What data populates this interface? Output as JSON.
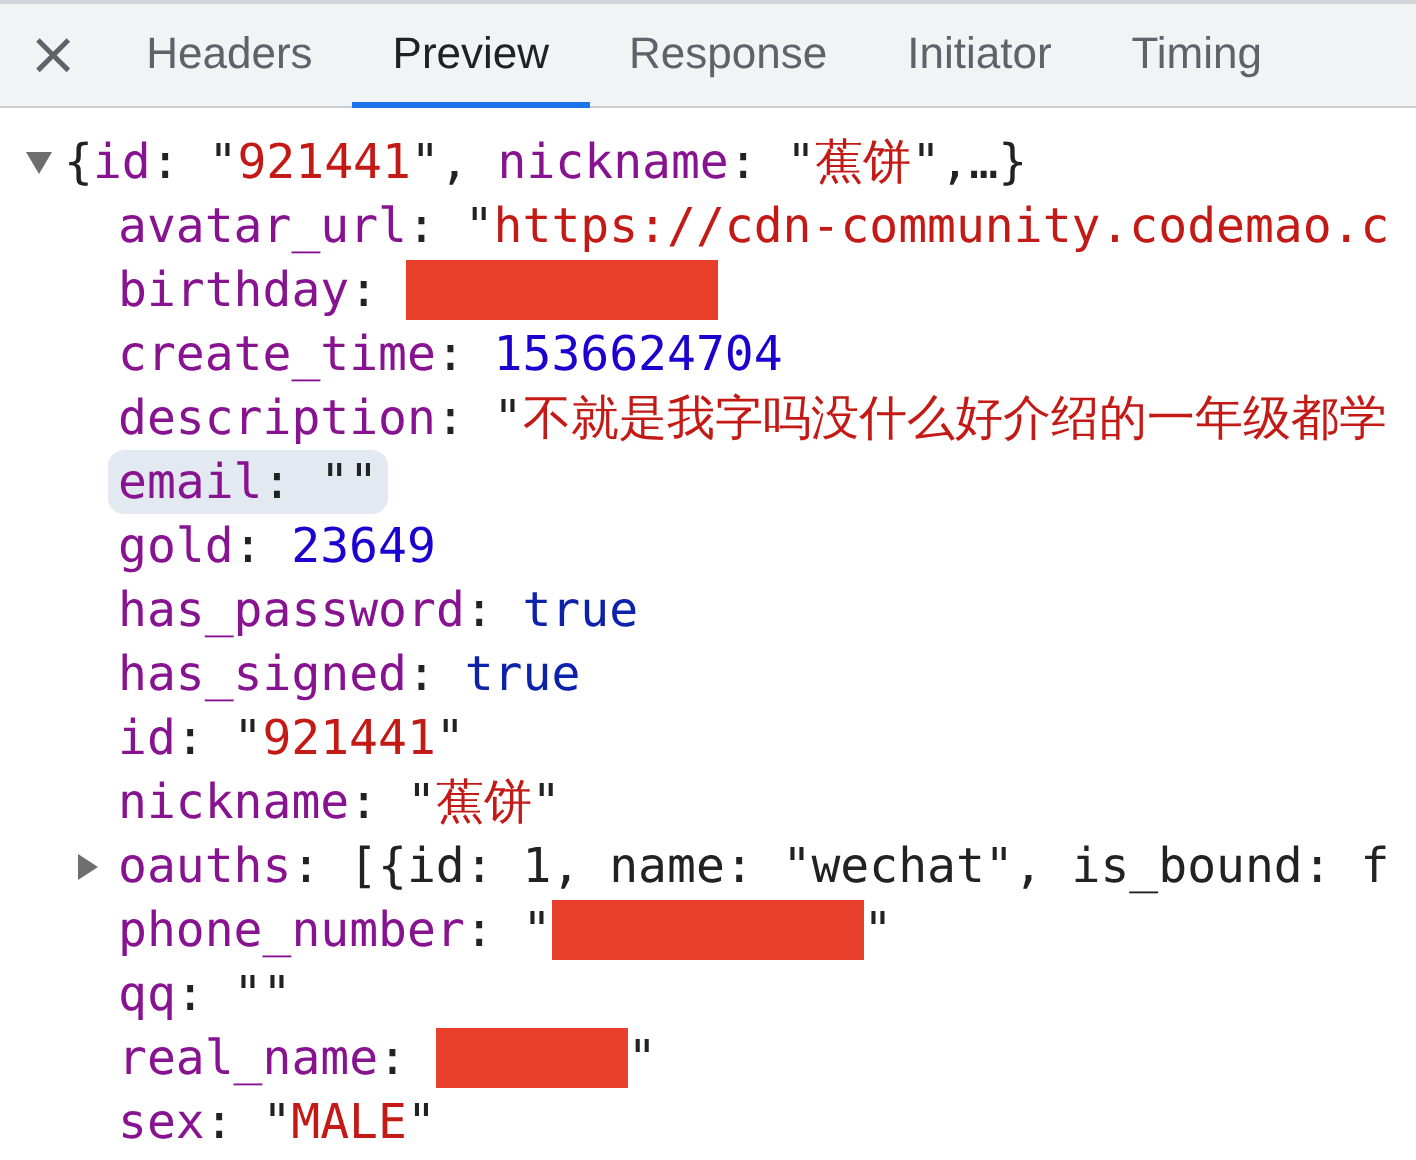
{
  "close_label": "×",
  "tabs": [
    {
      "label": "Headers",
      "selected": false
    },
    {
      "label": "Preview",
      "selected": true
    },
    {
      "label": "Response",
      "selected": false
    },
    {
      "label": "Initiator",
      "selected": false
    },
    {
      "label": "Timing",
      "selected": false
    }
  ],
  "tree": {
    "expanded": true,
    "highlighted": false,
    "value": [
      {
        "kind": "punct",
        "text": "{"
      },
      {
        "kind": "key",
        "text": "id"
      },
      {
        "kind": "punct",
        "text": ": \""
      },
      {
        "kind": "string",
        "text": "921441"
      },
      {
        "kind": "punct",
        "text": "\", "
      },
      {
        "kind": "key",
        "text": "nickname"
      },
      {
        "kind": "punct",
        "text": ": \""
      },
      {
        "kind": "string",
        "text": "蕉饼"
      },
      {
        "kind": "punct",
        "text": "\",…}"
      }
    ],
    "children": [
      {
        "highlighted": false,
        "key": [
          {
            "kind": "key",
            "text": "avatar_url"
          },
          {
            "kind": "punct",
            "text": ":"
          }
        ],
        "value": [
          {
            "kind": "punct",
            "text": "\""
          },
          {
            "kind": "string",
            "text": "https://cdn-community.codemao.c"
          }
        ]
      },
      {
        "highlighted": false,
        "key": [
          {
            "kind": "key",
            "text": "birthday"
          },
          {
            "kind": "punct",
            "text": ":"
          }
        ],
        "value": [
          {
            "kind": "redaction",
            "wide": true
          }
        ]
      },
      {
        "highlighted": false,
        "key": [
          {
            "kind": "key",
            "text": "create_time"
          },
          {
            "kind": "punct",
            "text": ":"
          }
        ],
        "value": [
          {
            "kind": "number",
            "text": "1536624704"
          }
        ]
      },
      {
        "highlighted": false,
        "key": [
          {
            "kind": "key",
            "text": "description"
          },
          {
            "kind": "punct",
            "text": ":"
          }
        ],
        "value": [
          {
            "kind": "punct",
            "text": "\""
          },
          {
            "kind": "string",
            "text": "不就是我字吗没什么好介绍的一年级都学"
          }
        ]
      },
      {
        "highlighted": true,
        "key": [
          {
            "kind": "key",
            "text": "email"
          },
          {
            "kind": "punct",
            "text": ":"
          }
        ],
        "value": [
          {
            "kind": "punct",
            "text": "\"\""
          }
        ]
      },
      {
        "highlighted": false,
        "key": [
          {
            "kind": "key",
            "text": "gold"
          },
          {
            "kind": "punct",
            "text": ":"
          }
        ],
        "value": [
          {
            "kind": "number",
            "text": "23649"
          }
        ]
      },
      {
        "highlighted": false,
        "key": [
          {
            "kind": "key",
            "text": "has_password"
          },
          {
            "kind": "punct",
            "text": ":"
          }
        ],
        "value": [
          {
            "kind": "boolean",
            "text": "true"
          }
        ]
      },
      {
        "highlighted": false,
        "key": [
          {
            "kind": "key",
            "text": "has_signed"
          },
          {
            "kind": "punct",
            "text": ":"
          }
        ],
        "value": [
          {
            "kind": "boolean",
            "text": "true"
          }
        ]
      },
      {
        "highlighted": false,
        "key": [
          {
            "kind": "key",
            "text": "id"
          },
          {
            "kind": "punct",
            "text": ":"
          }
        ],
        "value": [
          {
            "kind": "punct",
            "text": "\""
          },
          {
            "kind": "string",
            "text": "921441"
          },
          {
            "kind": "punct",
            "text": "\""
          }
        ]
      },
      {
        "highlighted": false,
        "key": [
          {
            "kind": "key",
            "text": "nickname"
          },
          {
            "kind": "punct",
            "text": ":"
          }
        ],
        "value": [
          {
            "kind": "punct",
            "text": "\""
          },
          {
            "kind": "string",
            "text": "蕉饼"
          },
          {
            "kind": "punct",
            "text": "\""
          }
        ]
      },
      {
        "highlighted": false,
        "expanded": false,
        "key": [
          {
            "kind": "key",
            "text": "oauths"
          },
          {
            "kind": "punct",
            "text": ":"
          }
        ],
        "value": [
          {
            "kind": "punct",
            "text": "[{id: 1, name: \"wechat\", is_bound: f"
          }
        ]
      },
      {
        "highlighted": false,
        "key": [
          {
            "kind": "key",
            "text": "phone_number"
          },
          {
            "kind": "punct",
            "text": ":"
          }
        ],
        "value": [
          {
            "kind": "punct",
            "text": "\""
          },
          {
            "kind": "redaction",
            "wide": true
          },
          {
            "kind": "punct",
            "text": "\""
          }
        ]
      },
      {
        "highlighted": false,
        "key": [
          {
            "kind": "key",
            "text": "qq"
          },
          {
            "kind": "punct",
            "text": ":"
          }
        ],
        "value": [
          {
            "kind": "punct",
            "text": "\"\""
          }
        ]
      },
      {
        "highlighted": false,
        "key": [
          {
            "kind": "key",
            "text": "real_name"
          },
          {
            "kind": "punct",
            "text": ":"
          }
        ],
        "value": [
          {
            "kind": "redaction",
            "wide": false
          },
          {
            "kind": "punct",
            "text": "\""
          }
        ]
      },
      {
        "highlighted": false,
        "key": [
          {
            "kind": "key",
            "text": "sex"
          },
          {
            "kind": "punct",
            "text": ":"
          }
        ],
        "value": [
          {
            "kind": "punct",
            "text": "\""
          },
          {
            "kind": "string",
            "text": "MALE"
          },
          {
            "kind": "punct",
            "text": "\""
          }
        ]
      }
    ]
  }
}
